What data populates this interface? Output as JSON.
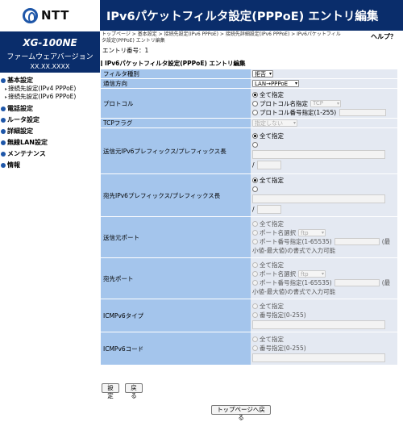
{
  "brand": {
    "logo_text": "NTT",
    "model": "XG-100NE",
    "firmware_label": "ファームウェアバージョン",
    "firmware_value": "XX.XX.XXXX"
  },
  "nav": {
    "basic": "基本設定",
    "basic_sub": [
      "接続先設定(IPv4 PPPoE)",
      "接続先設定(IPv6 PPPoE)"
    ],
    "items": [
      "電話設定",
      "ルータ設定",
      "詳細設定",
      "無線LAN設定",
      "メンテナンス",
      "情報"
    ]
  },
  "header": {
    "title": "IPv6パケットフィルタ設定(PPPoE) エントリ編集"
  },
  "breadcrumb": "トップページ > 基本設定 > 接続先設定(IPv6 PPPoE) > 接続先詳細設定(IPv6 PPPoE) > IPv6パケットフィルタ設定(PPPoE) エントリ編集",
  "help": "ヘルプ？",
  "entry_number": "エントリ番号：1",
  "section_title": "IPv6パケットフィルタ設定(PPPoE) エントリ編集",
  "form": {
    "filter_type": {
      "label": "フィルタ種別",
      "value": "拒否"
    },
    "direction": {
      "label": "通信方向",
      "value": "LAN→PPPoE"
    },
    "protocol": {
      "label": "プロトコル",
      "opt_all": "全て指定",
      "opt_name": "プロトコル名指定",
      "name_value": "TCP",
      "opt_number": "プロトコル番号指定(1-255)"
    },
    "tcp_flag": {
      "label": "TCPフラグ",
      "value": "指定しない"
    },
    "src_prefix": {
      "label": "送信元IPv6プレフィックス/プレフィックス長",
      "opt_all": "全て指定",
      "slash": "/"
    },
    "dst_prefix": {
      "label": "宛先IPv6プレフィックス/プレフィックス長",
      "opt_all": "全て指定",
      "slash": "/"
    },
    "src_port": {
      "label": "送信元ポート",
      "opt_all": "全て指定",
      "opt_name": "ポート名選択",
      "name_value": "ftp",
      "opt_number": "ポート番号指定(1-65535)",
      "hint_a": "(最",
      "hint_b": "小値-最大値)の書式で入力可能"
    },
    "dst_port": {
      "label": "宛先ポート",
      "opt_all": "全て指定",
      "opt_name": "ポート名選択",
      "name_value": "ftp",
      "opt_number": "ポート番号指定(1-65535)",
      "hint_a": "(最",
      "hint_b": "小値-最大値)の書式で入力可能"
    },
    "icmp_type": {
      "label": "ICMPv6タイプ",
      "opt_all": "全て指定",
      "opt_number": "番号指定(0-255)"
    },
    "icmp_code": {
      "label": "ICMPv6コード",
      "opt_all": "全て指定",
      "opt_number": "番号指定(0-255)"
    }
  },
  "buttons": {
    "set": "設定",
    "back": "戻る",
    "top": "トップページへ戻る"
  }
}
